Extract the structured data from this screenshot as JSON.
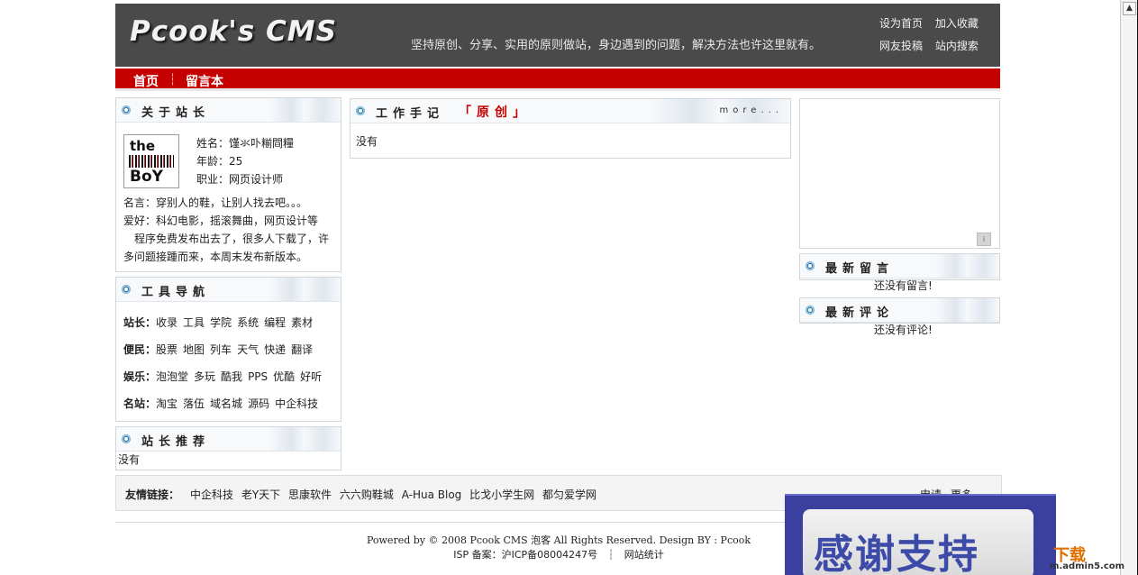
{
  "header": {
    "logo": "Pcook's CMS",
    "slogan": "坚持原创、分享、实用的原则做站，身边遇到的问题，解决方法也许这里就有。",
    "links": [
      "设为首页",
      "加入收藏",
      "网友投稿",
      "站内搜索"
    ]
  },
  "nav": {
    "items": [
      "首页",
      "留言本"
    ],
    "separator": "┆"
  },
  "about": {
    "title": "关于站长",
    "avatar_text": [
      "the",
      "BoY"
    ],
    "name": "姓名：馑氺卟糋閰糧",
    "age": "年龄：25",
    "job": "职业：网页设计师",
    "motto": "名言：穿别人的鞋，让别人找去吧。。。",
    "hobby": "爱好：科幻电影，摇滚舞曲，网页设计等",
    "note": "　程序免费发布出去了，很多人下载了，许多问题接踵而来，本周末发布新版本。"
  },
  "tools": {
    "title": "工具导航",
    "rows": [
      {
        "label": "站长：",
        "items": [
          "收录",
          "工具",
          "学院",
          "系统",
          "编程",
          "素材"
        ]
      },
      {
        "label": "便民：",
        "items": [
          "股票",
          "地图",
          "列车",
          "天气",
          "快递",
          "翻译"
        ]
      },
      {
        "label": "娱乐：",
        "items": [
          "泡泡堂",
          "多玩",
          "酷我",
          "PPS",
          "优酷",
          "好听"
        ]
      },
      {
        "label": "名站：",
        "items": [
          "淘宝",
          "落伍",
          "域名城",
          "源码",
          "中企科技"
        ]
      }
    ]
  },
  "recommend": {
    "title": "站长推荐",
    "content": "没有"
  },
  "work": {
    "title": "工作手记",
    "tag": "「原创」",
    "more": "more...",
    "content": "没有"
  },
  "latest_messages": {
    "title": "最新留言",
    "content": "还没有留言!"
  },
  "latest_comments": {
    "title": "最新评论",
    "content": "还没有评论!"
  },
  "friends": {
    "label": "友情链接：",
    "links": [
      "中企科技",
      "老Y天下",
      "思康软件",
      "六六购鞋城",
      "A-Hua Blog",
      "比戈小学生网",
      "都匀爱学网"
    ],
    "right_links": [
      "申请",
      "更多"
    ]
  },
  "footer": {
    "line1": "Powered by © 2008 Pcook CMS 泡客 All Rights Reserved. Design BY : Pcook",
    "icp": "ISP 备案：沪ICP备08004247号",
    "separator": "┆",
    "stats": "网站统计"
  },
  "overlay": {
    "thanks": "感谢支持",
    "watermark_brand": "下载",
    "watermark_url": "m.admin5.com"
  }
}
